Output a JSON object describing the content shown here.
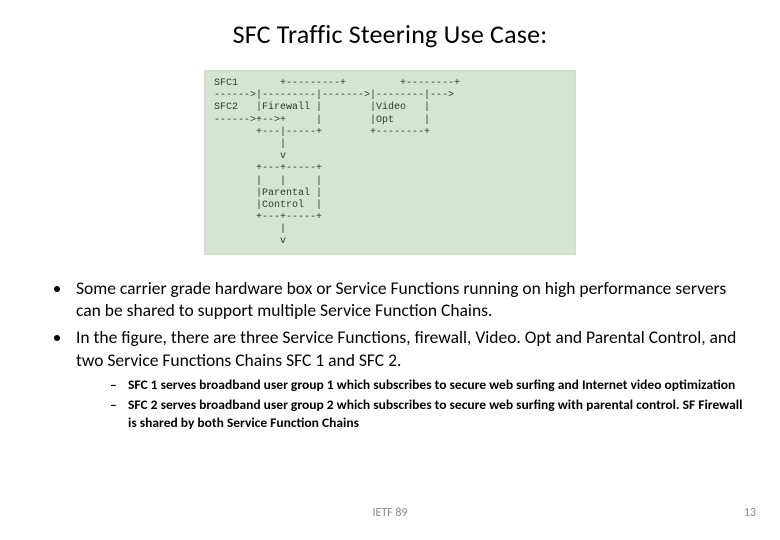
{
  "title": "SFC Traffic Steering Use Case:",
  "diagram": "SFC1       +---------+         +--------+\n------>|---------|------->|--------|--->\nSFC2   |Firewall |        |Video   |\n------>+-->+     |        |Opt     |\n       +---|-----+        +--------+\n           |\n           v\n       +---+-----+\n       |   |     |\n       |Parental |\n       |Control  |\n       +---+-----+\n           |\n           v",
  "bullets": {
    "b1": "Some carrier grade hardware box or Service Functions running on high performance servers can be shared to support multiple Service Function Chains.",
    "b2": "In the figure, there are three Service Functions, firewall, Video. Opt and Parental Control, and two Service Functions Chains SFC 1 and SFC 2.",
    "s1": "SFC 1 serves broadband user group 1 which subscribes to secure web surfing and Internet video optimization",
    "s2": "SFC 2 serves broadband user group 2 which subscribes to secure web surfing with parental control. SF Firewall is shared by both Service Function Chains"
  },
  "footer": {
    "center": "IETF 89",
    "right": "13"
  }
}
